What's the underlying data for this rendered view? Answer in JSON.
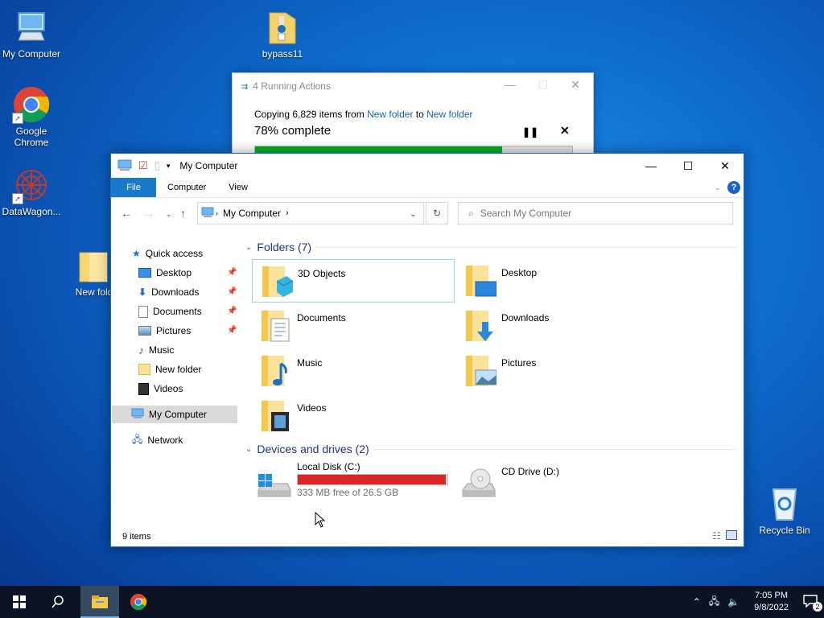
{
  "desktop": {
    "icons": [
      {
        "label": "My Computer"
      },
      {
        "label": "bypass11"
      },
      {
        "label": "Google Chrome"
      },
      {
        "label": "DataWagon..."
      },
      {
        "label": "New fold"
      },
      {
        "label": "Recycle Bin"
      }
    ]
  },
  "progress_dialog": {
    "title": "4 Running Actions",
    "copy_prefix": "Copying 6,829 items from",
    "source": "New folder",
    "to": "to",
    "dest": "New folder",
    "percent_text": "78% complete",
    "progress_fraction": 0.78
  },
  "explorer": {
    "title": "My Computer",
    "ribbon_tabs": [
      "File",
      "Computer",
      "View"
    ],
    "help_label": "?",
    "address": "My Computer",
    "search_placeholder": "Search My Computer",
    "nav": {
      "quick_access": "Quick access",
      "items": [
        {
          "label": "Desktop",
          "pinned": true
        },
        {
          "label": "Downloads",
          "pinned": true
        },
        {
          "label": "Documents",
          "pinned": true
        },
        {
          "label": "Pictures",
          "pinned": true
        },
        {
          "label": "Music",
          "pinned": false
        },
        {
          "label": "New folder",
          "pinned": false
        },
        {
          "label": "Videos",
          "pinned": false
        }
      ],
      "this_pc": "My Computer",
      "network": "Network"
    },
    "folders_header": "Folders (7)",
    "folders": [
      "3D Objects",
      "Desktop",
      "Documents",
      "Downloads",
      "Music",
      "Pictures",
      "Videos"
    ],
    "drives_header": "Devices and drives (2)",
    "drives": [
      {
        "label": "Local Disk (C:)",
        "free": "333 MB free of 26.5 GB",
        "used_fraction": 0.988
      },
      {
        "label": "CD Drive (D:)"
      }
    ],
    "status": "9 items"
  },
  "taskbar": {
    "time": "7:05 PM",
    "date": "9/8/2022",
    "notification_count": "2"
  },
  "colors": {
    "accent": "#1979ca",
    "progress_green": "#06b025",
    "disk_red": "#da2626",
    "taskbar": "#0b1325"
  }
}
